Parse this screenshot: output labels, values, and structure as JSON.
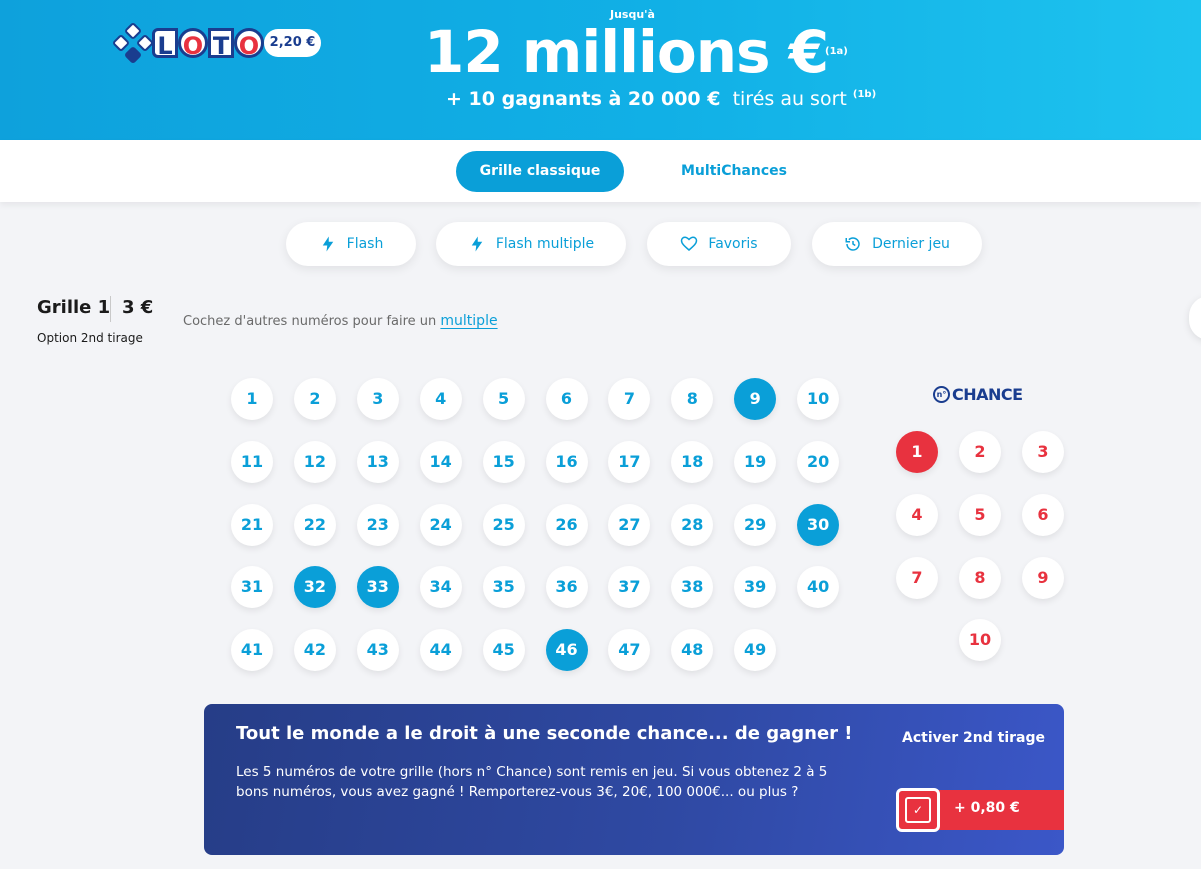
{
  "banner": {
    "logo_text": "LOTO",
    "ticket_price": "2,20 €",
    "jackpot_prefix": "Jusqu'à",
    "jackpot": "12 millions €",
    "jackpot_note": "(1a)",
    "secondary_bold": "+ 10 gagnants à 20 000 €",
    "secondary_rest": "tirés au sort",
    "secondary_note": "(1b)"
  },
  "tabs": [
    {
      "label": "Grille classique",
      "active": true
    },
    {
      "label": "MultiChances",
      "active": false
    }
  ],
  "quick_actions": [
    {
      "label": "Flash",
      "icon": "lightning-icon"
    },
    {
      "label": "Flash multiple",
      "icon": "lightning-icon"
    },
    {
      "label": "Favoris",
      "icon": "heart-icon"
    },
    {
      "label": "Dernier jeu",
      "icon": "history-icon"
    }
  ],
  "grid": {
    "title": "Grille 1",
    "price": "3 €",
    "option": "Option 2nd tirage",
    "hint_text": "Cochez d'autres numéros pour faire un",
    "hint_link": "multiple",
    "numbers": [
      1,
      2,
      3,
      4,
      5,
      6,
      7,
      8,
      9,
      10,
      11,
      12,
      13,
      14,
      15,
      16,
      17,
      18,
      19,
      20,
      21,
      22,
      23,
      24,
      25,
      26,
      27,
      28,
      29,
      30,
      31,
      32,
      33,
      34,
      35,
      36,
      37,
      38,
      39,
      40,
      41,
      42,
      43,
      44,
      45,
      46,
      47,
      48,
      49
    ],
    "selected": [
      9,
      30,
      32,
      33,
      46
    ]
  },
  "chance": {
    "logo_n": "n°",
    "logo_word": "CHANCE",
    "numbers": [
      1,
      2,
      3,
      4,
      5,
      6,
      7,
      8,
      9,
      10
    ],
    "selected": [
      1
    ]
  },
  "second_draw": {
    "title": "Tout le monde a le droit à une seconde chance... de gagner !",
    "description": "Les 5 numéros de votre grille (hors n° Chance) sont remis en jeu. Si vous obtenez 2 à 5 bons numéros, vous avez gagné ! Remporterez-vous 3€, 20€, 100 000€... ou plus ?",
    "activate_label": "Activer 2nd tirage",
    "checked": true,
    "price": "+ 0,80 €"
  },
  "colors": {
    "primary": "#0a9fd8",
    "chance": "#e8323f",
    "panel": "#2f49a3"
  }
}
